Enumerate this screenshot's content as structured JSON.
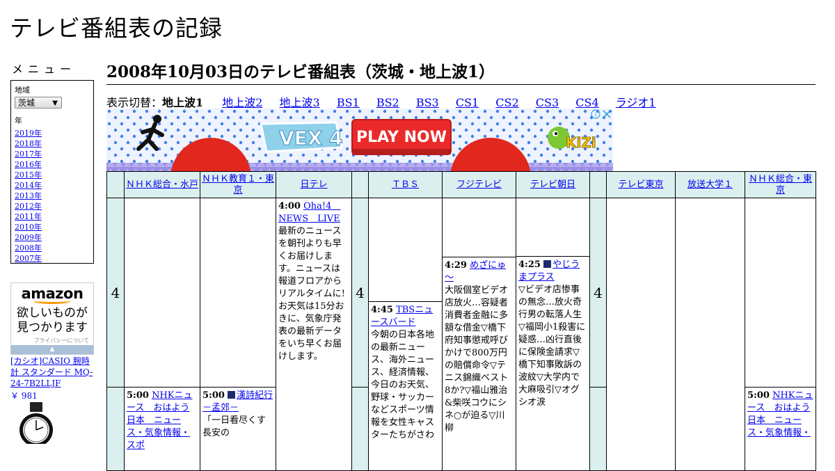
{
  "site_title": "テレビ番組表の記録",
  "sidebar": {
    "menu_label": "メニュー",
    "region_label": "地域",
    "region_value": "茨城",
    "year_label": "年",
    "years": [
      "2019年",
      "2018年",
      "2017年",
      "2016年",
      "2015年",
      "2014年",
      "2013年",
      "2012年",
      "2011年",
      "2010年",
      "2009年",
      "2008年",
      "2007年"
    ]
  },
  "amazon_ad": {
    "logo": "amazon",
    "tagline_1": "欲しいものが",
    "tagline_2": "見つかります",
    "privacy": "プライバシーについて",
    "product_title": "[カシオ]CASIO 腕時計 スタンダード MQ-24-7B2LLJF",
    "price": "￥ 981"
  },
  "page_title": "2008年10月03日のテレビ番組表（茨城・地上波1）",
  "switcher": {
    "label": "表示切替：",
    "current": "地上波1",
    "links": [
      "地上波2",
      "地上波3",
      "BS1",
      "BS2",
      "BS3",
      "CS1",
      "CS2",
      "CS3",
      "CS4",
      "ラジオ1"
    ]
  },
  "banner": {
    "logo": "VEX 4",
    "cta": "PLAY NOW",
    "brand": "KiZi"
  },
  "channels": [
    "ＮＨＫ総合・水戸",
    "ＮＨＫ教育１・東京",
    "日テレ",
    "ＴＢＳ",
    "フジテレビ",
    "テレビ朝日",
    "テレビ東京",
    "放送大学１",
    "ＮＨＫ総合・東京"
  ],
  "hour": "4",
  "programs": {
    "ntv_400": {
      "time": "4:00",
      "title": "Oha!4　NEWS　LIVE",
      "desc": "最新のニュースを朝刊よりも早くお届けします。ニュースは報道フロアからリアルタイムに!お天気は15分おきに、気象庁発表の最新データをいち早くお届けします。"
    },
    "tbs_445": {
      "time": "4:45",
      "title": "TBSニュースバード",
      "desc": "今朝の日本各地の最新ニュース、海外ニュース、経済情報、今日のお天気、野球・サッカーなどスポーツ情報を女性キャスターたちがさわ"
    },
    "fuji_429": {
      "time": "4:29",
      "title": "めざにゅ～",
      "desc": "大阪個室ビデオ店放火…容疑者消費者金融に多額な借金▽橋下府知事懲戒呼びかけで800万円の賠償命令▽テニス錦織ベスト8か?▽福山雅治&柴咲コウにシネ○が迫る▽川柳"
    },
    "asahi_425": {
      "time": "4:25",
      "title": "やじうまプラス",
      "desc": "▽ビデオ店惨事の無念…放火奇行男の転落人生▽福岡小1殺害に疑惑…凶行直後に保険金請求▽橋下知事敗訴の波紋▽大学内で大麻吸引▽オグシオ涙"
    },
    "nhk_mito_500": {
      "time": "5:00",
      "title": "NHKニュース　おはよう日本　ニュース・気象情報・スポ",
      "desc": ""
    },
    "etv_500": {
      "time": "5:00",
      "title": "漢詩紀行－孟郊－",
      "desc": "「一日看尽くす　長安の"
    },
    "nhk_tokyo_500": {
      "time": "5:00",
      "title": "NHKニュース　おはよう日本　ニュース・気象情報・",
      "desc": ""
    }
  }
}
